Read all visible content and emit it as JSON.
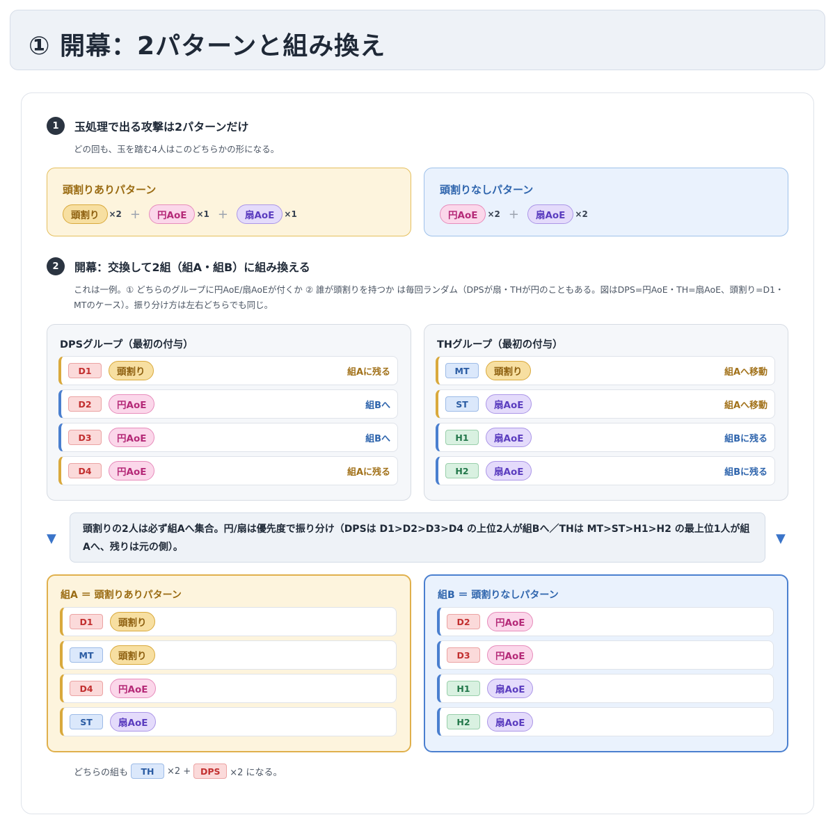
{
  "header": {
    "title": "① 開幕：2パターンと組み換え"
  },
  "step1": {
    "num": "1",
    "title": "玉処理で出る攻撃は2パターンだけ",
    "desc": "どの回も、玉を踏む4人はこのどちらかの形になる。",
    "pattern_head": {
      "title": "頭割りありパターン",
      "items": [
        {
          "label": "頭割り",
          "mult": "×2"
        },
        {
          "label": "円AoE",
          "mult": "×1"
        },
        {
          "label": "扇AoE",
          "mult": "×1"
        }
      ]
    },
    "pattern_nohead": {
      "title": "頭割りなしパターン",
      "items": [
        {
          "label": "円AoE",
          "mult": "×2"
        },
        {
          "label": "扇AoE",
          "mult": "×2"
        }
      ]
    },
    "plus": "+"
  },
  "step2": {
    "num": "2",
    "title": "開幕：交換して2組（組A・組B）に組み換える",
    "desc_line1": "これは一例。① どちらのグループに円AoE/扇AoEが付くか ② 誰が頭割りを持つか は毎回ランダム（DPSが扇・THが円のこともある。図はDPS=円AoE・TH=扇AoE、頭割り=D1・",
    "desc_line2": "MTのケース）。振り分け方は左右どちらでも同じ。"
  },
  "dps_group": {
    "title": "DPSグループ（最初の付与）",
    "rows": [
      {
        "role": "D1",
        "aoe": "頭割り",
        "note": "組Aに残る"
      },
      {
        "role": "D2",
        "aoe": "円AoE",
        "note": "組Bへ"
      },
      {
        "role": "D3",
        "aoe": "円AoE",
        "note": "組Bへ"
      },
      {
        "role": "D4",
        "aoe": "円AoE",
        "note": "組Aに残る"
      }
    ]
  },
  "th_group": {
    "title": "THグループ（最初の付与）",
    "rows": [
      {
        "role": "MT",
        "aoe": "頭割り",
        "note": "組Aへ移動"
      },
      {
        "role": "ST",
        "aoe": "扇AoE",
        "note": "組Aへ移動"
      },
      {
        "role": "H1",
        "aoe": "扇AoE",
        "note": "組Bに残る"
      },
      {
        "role": "H2",
        "aoe": "扇AoE",
        "note": "組Bに残る"
      }
    ]
  },
  "callout": {
    "arrow": "▼",
    "text": "頭割りの2人は必ず組Aへ集合。円/扇は優先度で振り分け（DPSは D1>D2>D3>D4 の上位2人が組Bへ／THは MT>ST>H1>H2 の最上位1人が組Aへ、残りは元の側）。"
  },
  "team_a": {
    "title": "組A ＝ 頭割りありパターン",
    "rows": [
      {
        "role": "D1",
        "aoe": "頭割り"
      },
      {
        "role": "MT",
        "aoe": "頭割り"
      },
      {
        "role": "D4",
        "aoe": "円AoE"
      },
      {
        "role": "ST",
        "aoe": "扇AoE"
      }
    ]
  },
  "team_b": {
    "title": "組B ＝ 頭割りなしパターン",
    "rows": [
      {
        "role": "D2",
        "aoe": "円AoE"
      },
      {
        "role": "D3",
        "aoe": "円AoE"
      },
      {
        "role": "H1",
        "aoe": "扇AoE"
      },
      {
        "role": "H2",
        "aoe": "扇AoE"
      }
    ]
  },
  "footer": {
    "prefix": "どちらの組も",
    "th": "TH",
    "th_mult": "×2 +",
    "dps": "DPS",
    "suffix": "×2 になる。"
  },
  "colors": {
    "head": "#f7dfa1",
    "circle": "#fbd7ea",
    "fan": "#e4dbfb",
    "dps": "#fbdada",
    "tank": "#dbe8fb",
    "healer": "#d9f1e1",
    "team_a_border": "#e0b04c",
    "team_b_border": "#4a7fcf"
  }
}
